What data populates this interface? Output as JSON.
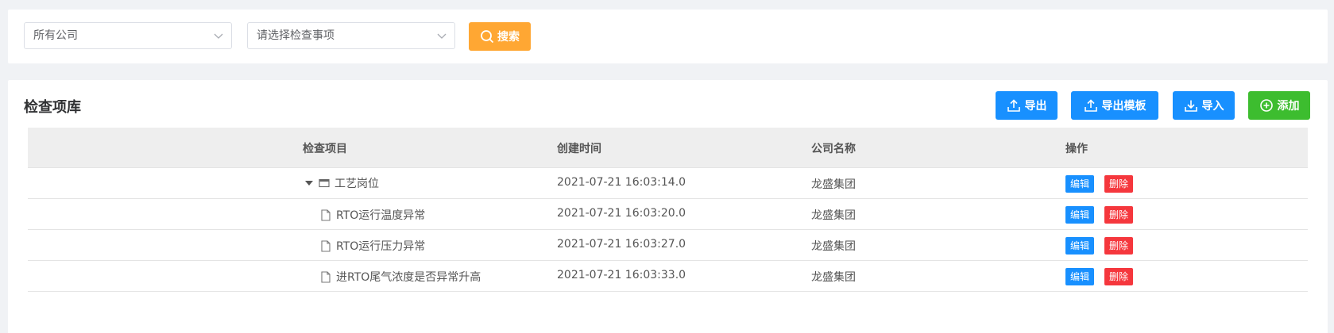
{
  "filters": {
    "company_select": "所有公司",
    "item_select_placeholder": "请选择检查事项",
    "search_label": "搜索"
  },
  "panel": {
    "title": "检查项库",
    "buttons": {
      "export": "导出",
      "export_template": "导出模板",
      "import": "导入",
      "add": "添加"
    }
  },
  "table": {
    "headers": {
      "item": "检查项目",
      "created": "创建时间",
      "company": "公司名称",
      "actions": "操作"
    },
    "rows": [
      {
        "item": "工艺岗位",
        "created": "2021-07-21 16:03:14.0",
        "company": "龙盛集团",
        "type": "folder"
      },
      {
        "item": "RTO运行温度异常",
        "created": "2021-07-21 16:03:20.0",
        "company": "龙盛集团",
        "type": "file"
      },
      {
        "item": "RTO运行压力异常",
        "created": "2021-07-21 16:03:27.0",
        "company": "龙盛集团",
        "type": "file"
      },
      {
        "item": "进RTO尾气浓度是否异常升高",
        "created": "2021-07-21 16:03:33.0",
        "company": "龙盛集团",
        "type": "file"
      }
    ],
    "edit_label": "编辑",
    "delete_label": "删除"
  },
  "colors": {
    "search": "#ffa733",
    "primary": "#1890ff",
    "add": "#3dbd2f",
    "delete": "#f5373d"
  }
}
